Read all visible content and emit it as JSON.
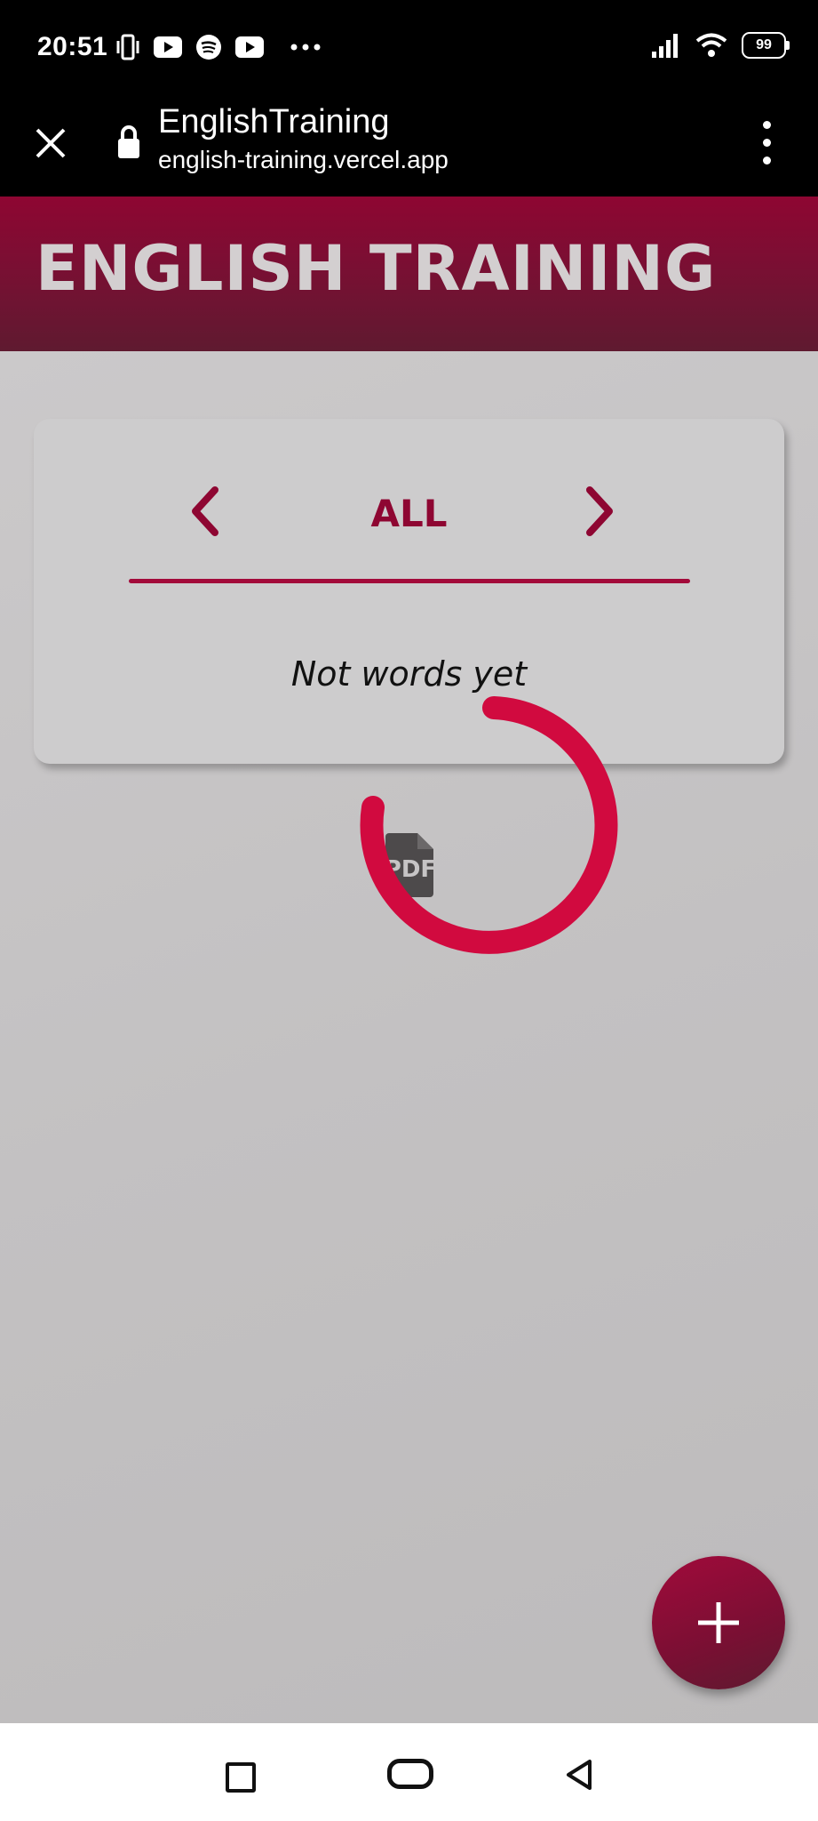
{
  "status_bar": {
    "time": "20:51",
    "battery": "99",
    "left_icons": [
      "vibrate-icon",
      "youtube-icon",
      "spotify-icon",
      "youtube-icon",
      "more-icon"
    ],
    "right_icons": [
      "signal-icon",
      "wifi-icon",
      "battery-icon"
    ]
  },
  "browser": {
    "page_title": "EnglishTraining",
    "url": "english-training.vercel.app"
  },
  "app": {
    "title": "ENGLISH TRAINING"
  },
  "card": {
    "category": "ALL",
    "empty_message": "Not words yet"
  },
  "overlay": {
    "pdf_icon_label": "PDF"
  },
  "colors": {
    "accent": "#8e0632",
    "spinner": "#d10a3f",
    "header_dark": "#5f1a30"
  }
}
